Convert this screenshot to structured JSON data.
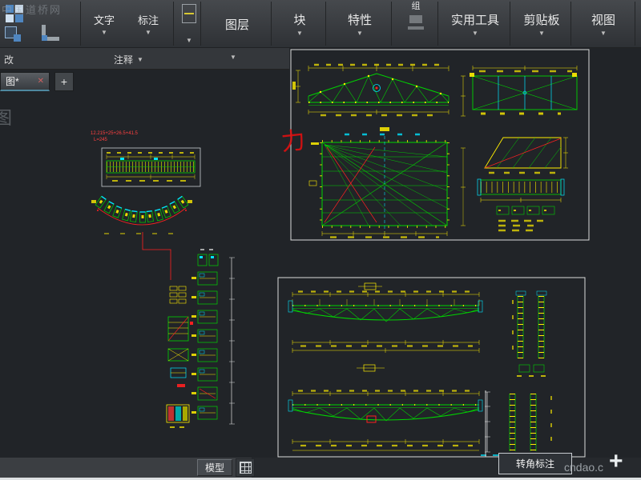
{
  "watermarks": {
    "top_left": "中国道桥网",
    "left_char": "图",
    "red_char": "力",
    "bottom_right": "cndao.c",
    "plus": "+"
  },
  "ribbon": {
    "text_panel": "文字",
    "dim_panel": "标注",
    "annotate_label": "注释",
    "modify_label": "改",
    "layers_panel": "图层",
    "block_panel": "块",
    "properties_panel": "特性",
    "group_panel": "组",
    "utilities_panel": "实用工具",
    "clipboard_panel": "剪贴板",
    "view_panel": "视图",
    "caret": "▼"
  },
  "tabs": {
    "drawing_tab": "图*",
    "close": "✕",
    "new_tab": "+"
  },
  "statusbar": {
    "model_label": "模型"
  },
  "tooltip": "转角标注",
  "canvas_notes": {
    "red_line1": "12.215+25+26.5+41.5",
    "red_line2": "L=245"
  }
}
